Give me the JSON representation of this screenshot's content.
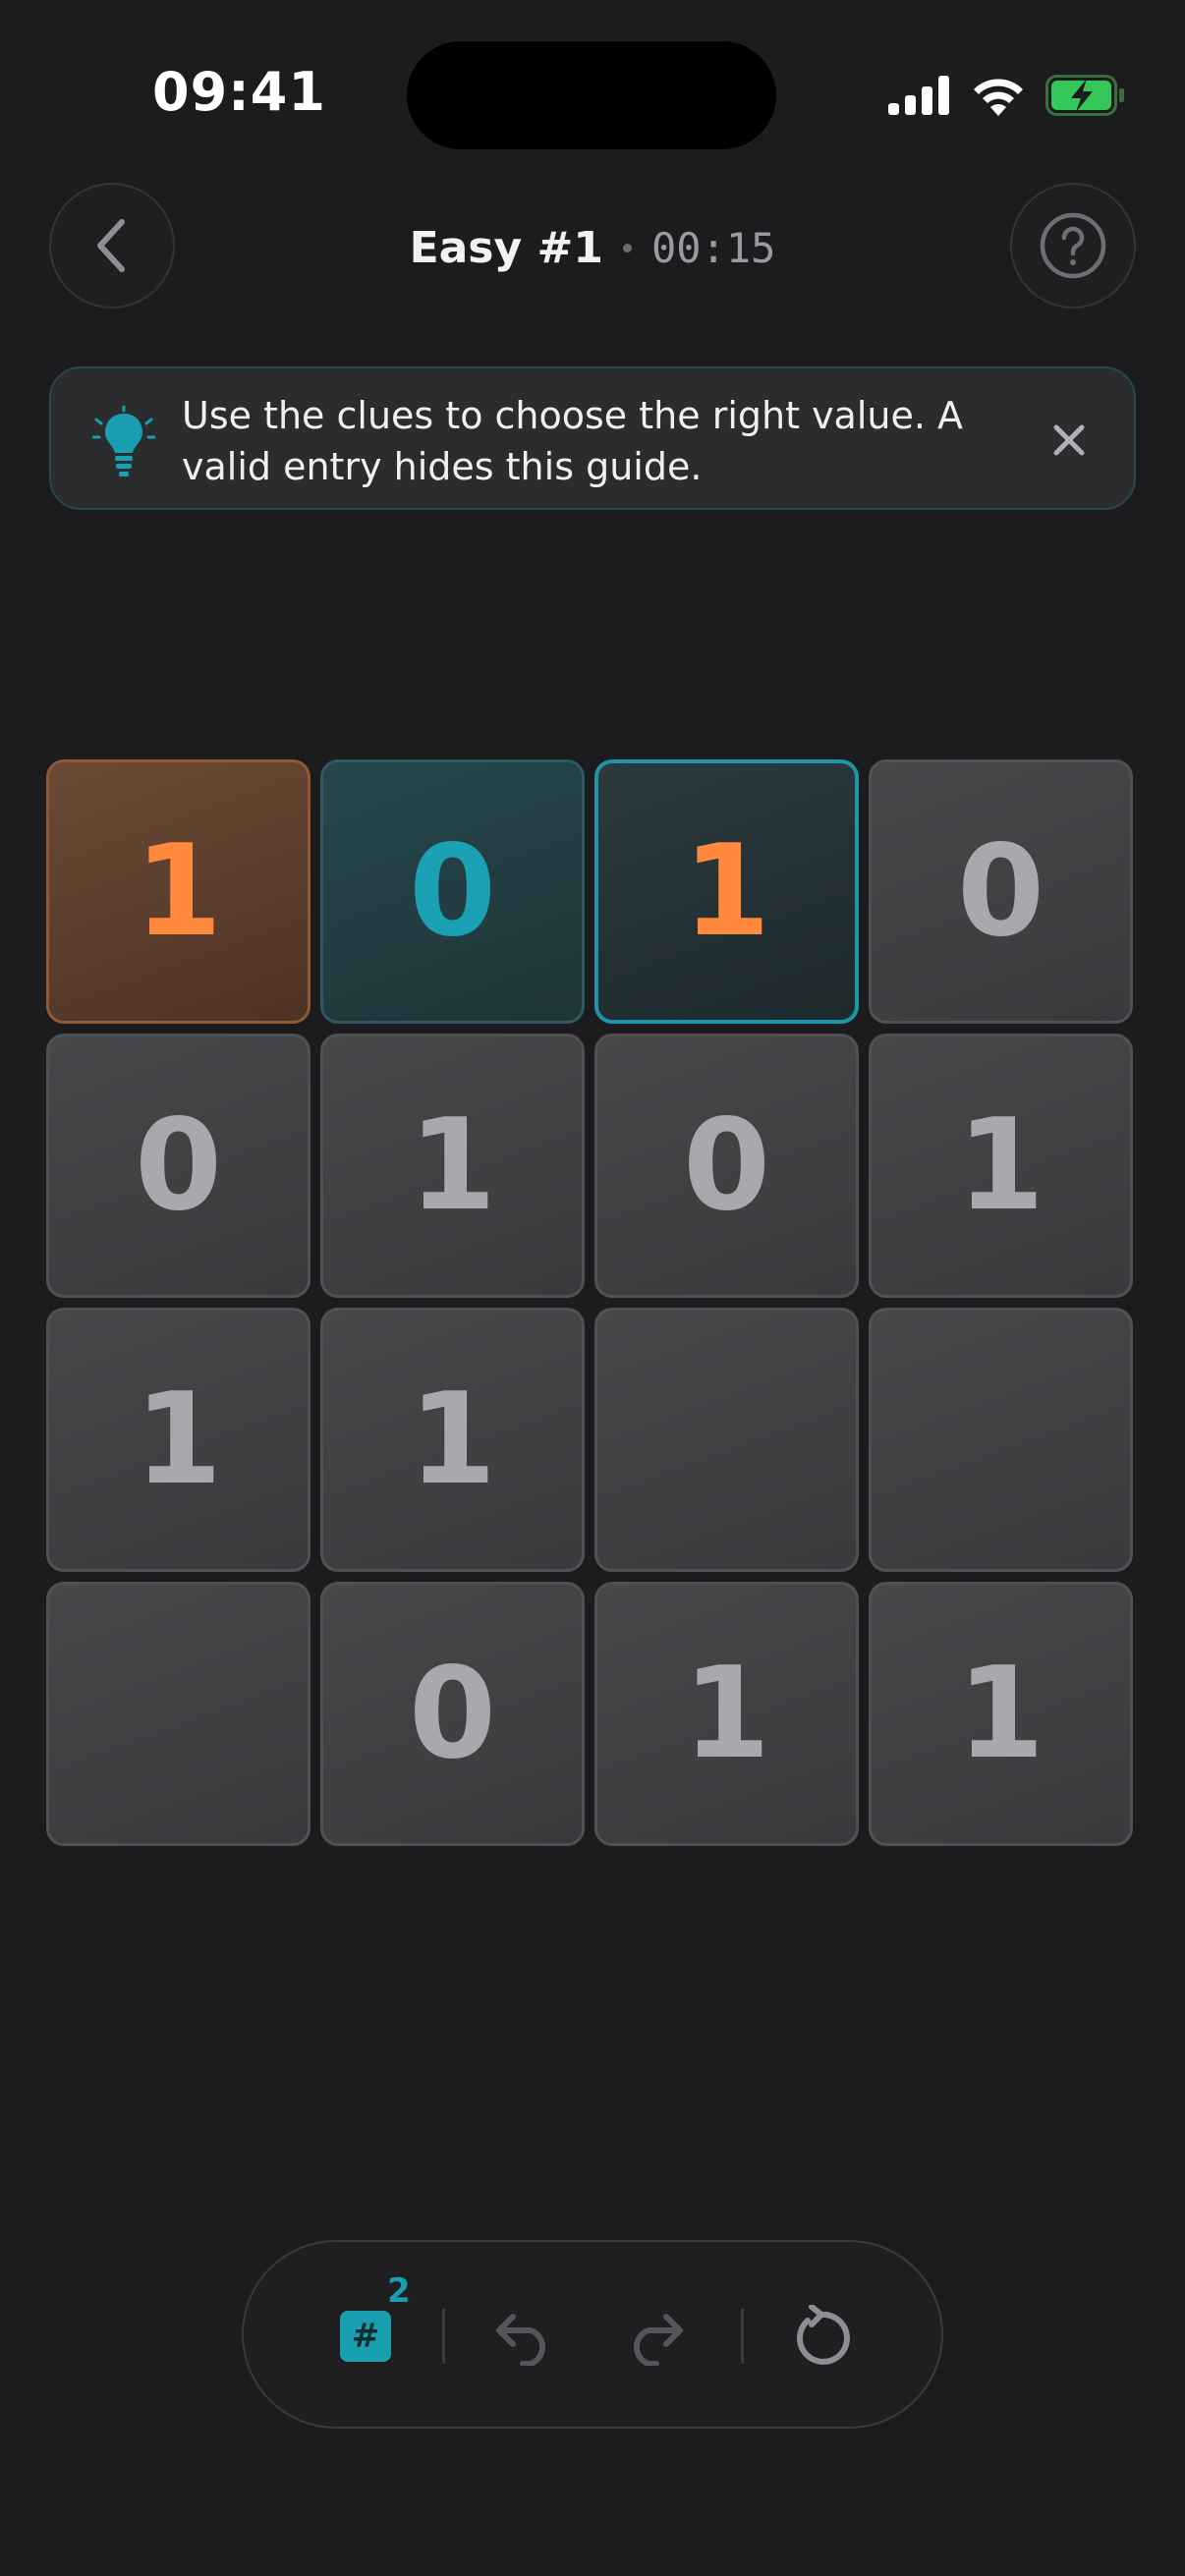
{
  "status_bar": {
    "time": "09:41",
    "icons": [
      "cellular-signal-icon",
      "wifi-icon",
      "battery-charging-icon"
    ]
  },
  "header": {
    "title": "Easy #1",
    "timer": "00:15",
    "back_icon": "chevron-left-icon",
    "help_icon": "question-mark-icon"
  },
  "tip": {
    "icon": "lightbulb-icon",
    "text": "Use the clues to choose the right value. A valid entry hides this guide.",
    "close_icon": "close-icon"
  },
  "grid": {
    "rows": [
      [
        {
          "value": "1",
          "state": "orange"
        },
        {
          "value": "0",
          "state": "teal"
        },
        {
          "value": "1",
          "state": "selected"
        },
        {
          "value": "0",
          "state": "given"
        }
      ],
      [
        {
          "value": "0",
          "state": "given"
        },
        {
          "value": "1",
          "state": "given"
        },
        {
          "value": "0",
          "state": "given"
        },
        {
          "value": "1",
          "state": "given"
        }
      ],
      [
        {
          "value": "1",
          "state": "given"
        },
        {
          "value": "1",
          "state": "given"
        },
        {
          "value": "",
          "state": "empty"
        },
        {
          "value": "",
          "state": "empty"
        }
      ],
      [
        {
          "value": "",
          "state": "empty"
        },
        {
          "value": "0",
          "state": "given"
        },
        {
          "value": "1",
          "state": "given"
        },
        {
          "value": "1",
          "state": "given"
        }
      ]
    ]
  },
  "toolbar": {
    "hint_symbol": "#",
    "hint_count": "2",
    "undo_icon": "undo-icon",
    "redo_icon": "redo-icon",
    "reset_icon": "restart-icon"
  },
  "colors": {
    "background": "#1c1c1e",
    "accent_teal": "#1a9fb0",
    "accent_orange": "#ff8a3d",
    "cell_text": "#a9a9ad"
  }
}
